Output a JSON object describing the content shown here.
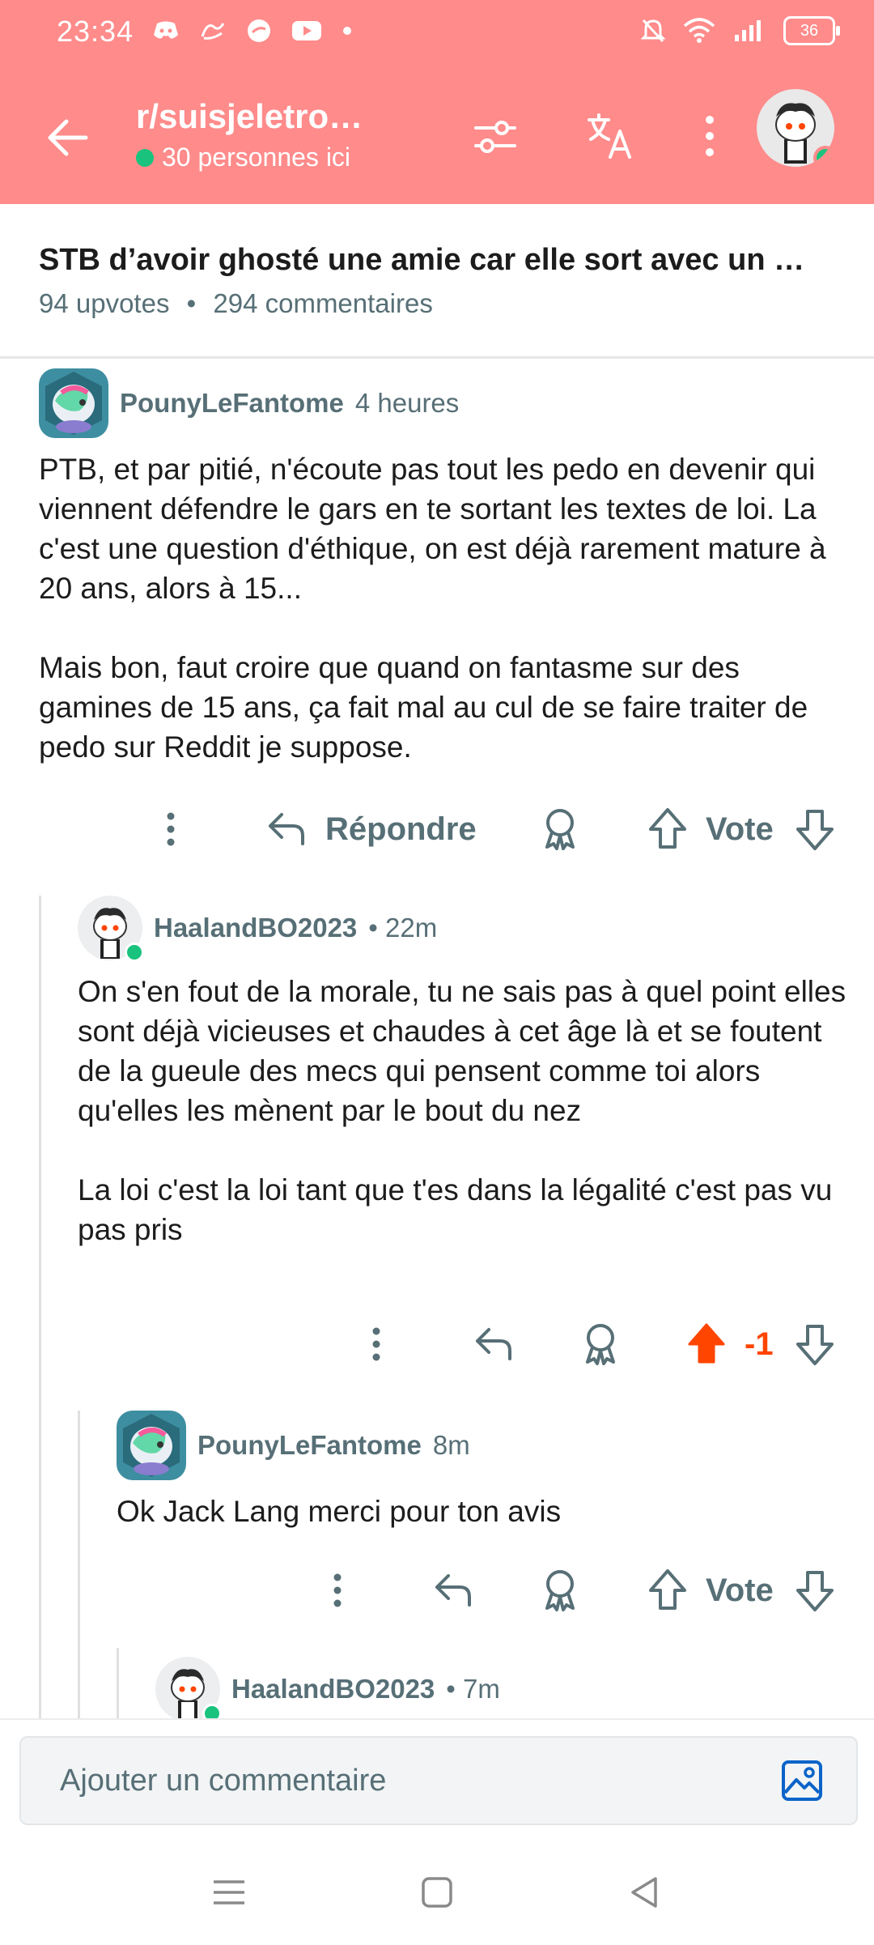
{
  "status": {
    "time": "23:34",
    "battery": "36"
  },
  "header": {
    "subreddit": "r/suisjeletro…",
    "online": "30 personnes ici"
  },
  "post": {
    "title": "STB d’avoir ghosté une amie car elle sort avec un …",
    "upvotes": "94 upvotes",
    "comments": "294 commentaires",
    "meta_sep": "•"
  },
  "comments": [
    {
      "user": "PounyLeFantome",
      "time": "4 heures",
      "paragraphs": [
        "PTB, et par pitié, n'écoute pas tout les pedo en devenir qui viennent défendre le gars en te sortant les textes de loi. La c'est une question d'éthique, on est déjà rarement mature à 20 ans, alors à 15...",
        "Mais bon, faut croire que quand on fantasme sur des gamines de 15 ans, ça fait mal au cul de se faire traiter de pedo sur Reddit je suppose."
      ],
      "reply_label": "Répondre",
      "vote_label": "Vote"
    },
    {
      "user": "HaalandBO2023",
      "time": "• 22m",
      "paragraphs": [
        "On s'en fout de la morale, tu ne sais pas à quel point elles sont déjà vicieuses et chaudes à cet âge là et se foutent de la gueule des mecs qui pensent comme toi alors qu'elles les mènent par le bout du nez",
        "La loi c'est la loi tant que t'es dans la légalité c'est pas vu pas pris"
      ],
      "score": "-1"
    },
    {
      "user": "PounyLeFantome",
      "time": "8m",
      "paragraphs": [
        "Ok Jack Lang merci pour ton avis"
      ],
      "vote_label": "Vote"
    },
    {
      "user": "HaalandBO2023",
      "time": "• 7m"
    }
  ],
  "composer": {
    "placeholder": "Ajouter un commentaire"
  },
  "colors": {
    "header_bg": "#ff8b8b",
    "upvote_active": "#ff4500",
    "online": "#19c37d"
  },
  "icons": [
    "back-arrow-icon",
    "filter-icon",
    "translate-icon",
    "more-icon",
    "reply-icon",
    "award-icon",
    "upvote-icon",
    "downvote-icon",
    "image-icon",
    "menu-icon",
    "home-icon",
    "back-nav-icon"
  ]
}
